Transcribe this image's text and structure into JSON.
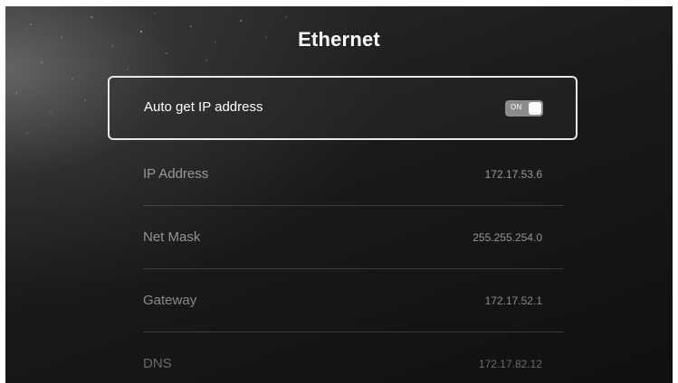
{
  "header": {
    "title": "Ethernet"
  },
  "auto_ip": {
    "label": "Auto get IP address",
    "toggle_text": "ON",
    "enabled": true
  },
  "settings": [
    {
      "label": "IP Address",
      "value": "172.17.53.6"
    },
    {
      "label": "Net Mask",
      "value": "255.255.254.0"
    },
    {
      "label": "Gateway",
      "value": "172.17.52.1"
    },
    {
      "label": "DNS",
      "value": "172.17.82.12"
    }
  ],
  "colors": {
    "text_primary": "#ffffff",
    "text_secondary": "#9a9a9a",
    "toggle_track": "#8c8c8c",
    "focus_border": "#e8e8e8"
  }
}
